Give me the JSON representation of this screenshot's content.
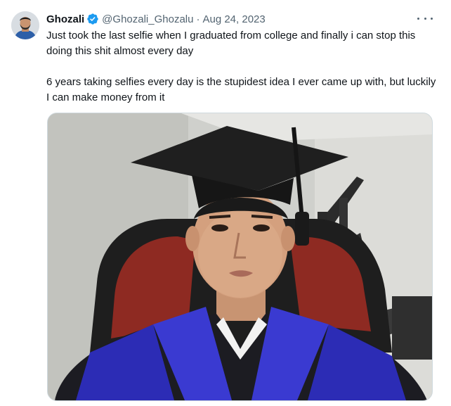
{
  "tweet": {
    "author_name": "Ghozali",
    "handle": "@Ghozali_Ghozalu",
    "separator": "·",
    "date": "Aug 24, 2023",
    "paragraphs": [
      "Just took the last selfie when I graduated from college and finally i can stop this doing this shit almost every day",
      "6 years taking selfies every day is the stupidest idea I ever came up with, but luckily I can make money from it"
    ]
  },
  "colors": {
    "verified_badge": "#1d9bf0",
    "secondary_text": "#536471",
    "primary_text": "#0f1419"
  },
  "icons": {
    "verified": "verified-badge-icon",
    "more": "more-options-icon"
  }
}
